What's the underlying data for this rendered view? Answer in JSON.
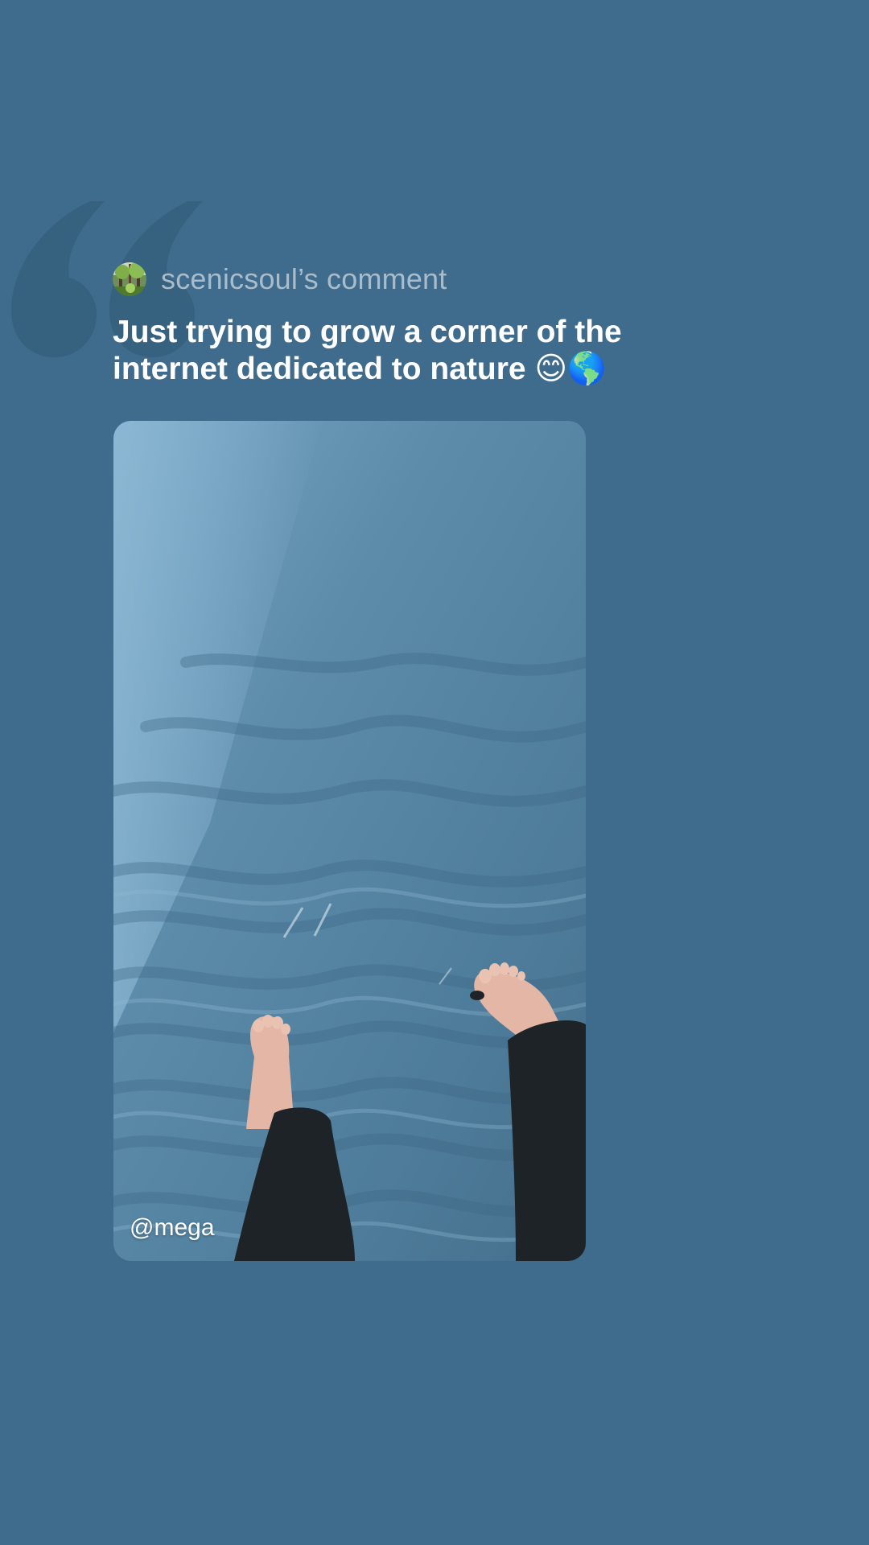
{
  "comment": {
    "author": "scenicsoul’s comment",
    "text": "Just trying to grow a corner of the internet dedicated to nature",
    "emojis": [
      "😊",
      "🌎"
    ]
  },
  "video": {
    "handle": "@mega"
  },
  "colors": {
    "background": "#3f6b8c",
    "quote_mark": "#36617f",
    "author_text": "#a9bccb",
    "comment_text": "#ffffff"
  },
  "icons": {
    "quote": "quote-mark-icon",
    "avatar": "avatar-nature-image"
  }
}
